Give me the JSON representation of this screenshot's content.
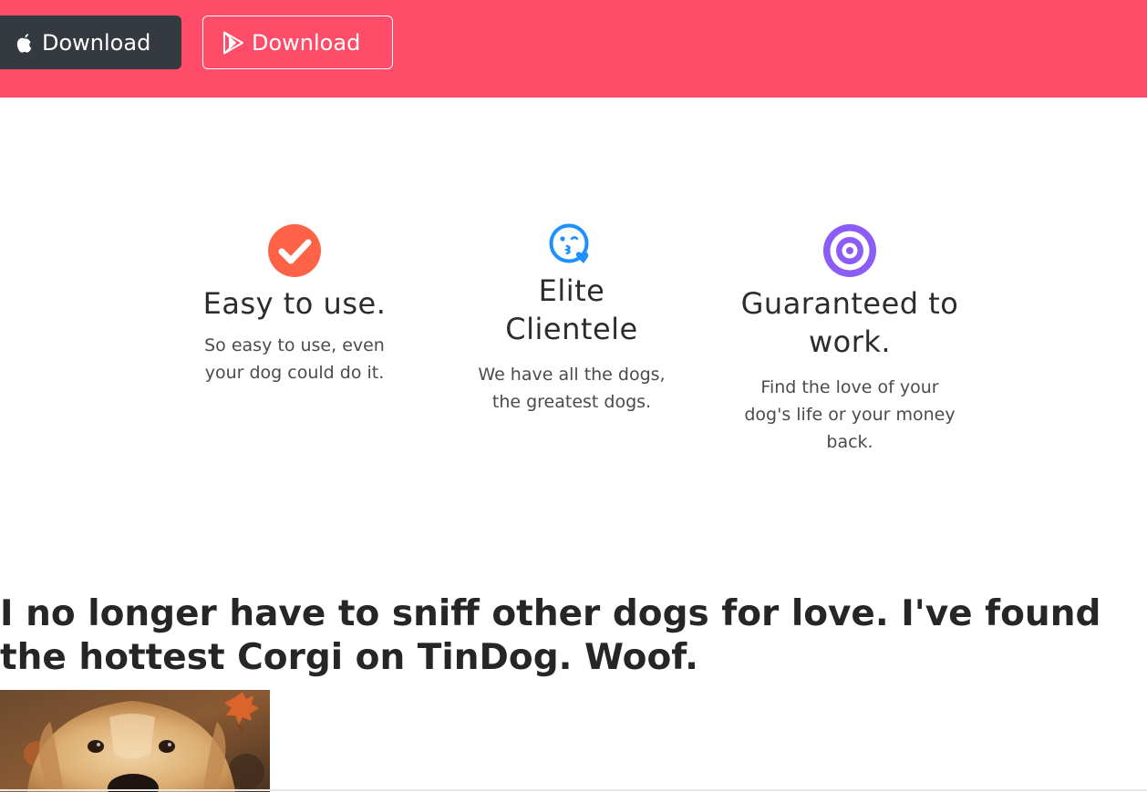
{
  "hero": {
    "apple_button_label": "Download",
    "play_button_label": "Download",
    "background_color": "#ff4c68"
  },
  "features": [
    {
      "icon": "check-circle-icon",
      "icon_color": "#ff6347",
      "title": "Easy to use.",
      "text": "So easy to use, even your dog could do it."
    },
    {
      "icon": "kiss-heart-icon",
      "icon_color": "#1e90ff",
      "title": "Elite Clientele",
      "text": "We have all the dogs, the greatest dogs."
    },
    {
      "icon": "bullseye-icon",
      "icon_color": "#8b5cf6",
      "title": "Guaranteed to work.",
      "text": "Find the love of your dog's life or your money back."
    }
  ],
  "testimonial": {
    "quote": "I no longer have to sniff other dogs for love. I've found the hottest Corgi on TinDog. Woof."
  }
}
